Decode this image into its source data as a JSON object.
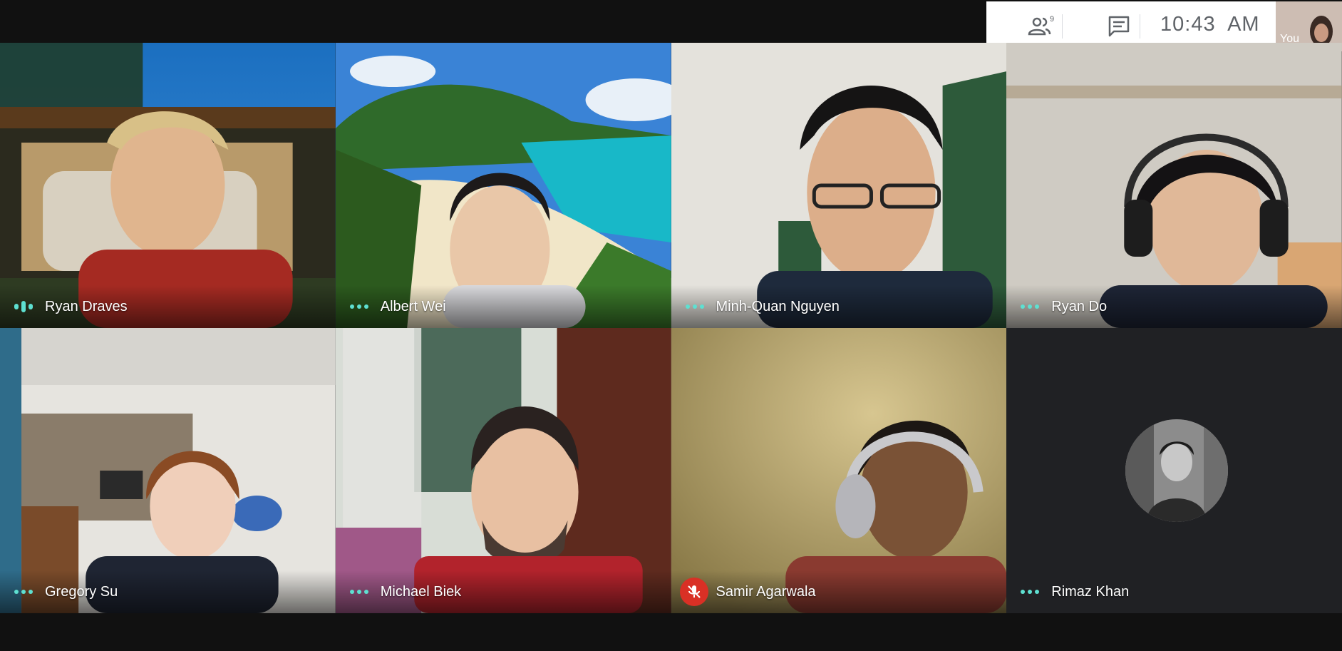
{
  "toolbar": {
    "people_icon": "people-icon",
    "people_badge": "9",
    "chat_icon": "chat-icon",
    "time": "10:43  AM"
  },
  "self_view": {
    "label": "You"
  },
  "participants": [
    {
      "name": "Ryan Draves",
      "status": "speaking"
    },
    {
      "name": "Albert Wei",
      "status": "idle"
    },
    {
      "name": "Minh-Quan Nguyen",
      "status": "idle"
    },
    {
      "name": "Ryan Do",
      "status": "idle"
    },
    {
      "name": "Gregory Su",
      "status": "idle"
    },
    {
      "name": "Michael Biek",
      "status": "idle"
    },
    {
      "name": "Samir Agarwala",
      "status": "muted"
    },
    {
      "name": "Rimaz Khan",
      "status": "idle"
    }
  ],
  "colors": {
    "background": "#111111",
    "indicator": "#5ee0d1",
    "mute_red": "#d93025",
    "empty_tile": "#202124"
  }
}
